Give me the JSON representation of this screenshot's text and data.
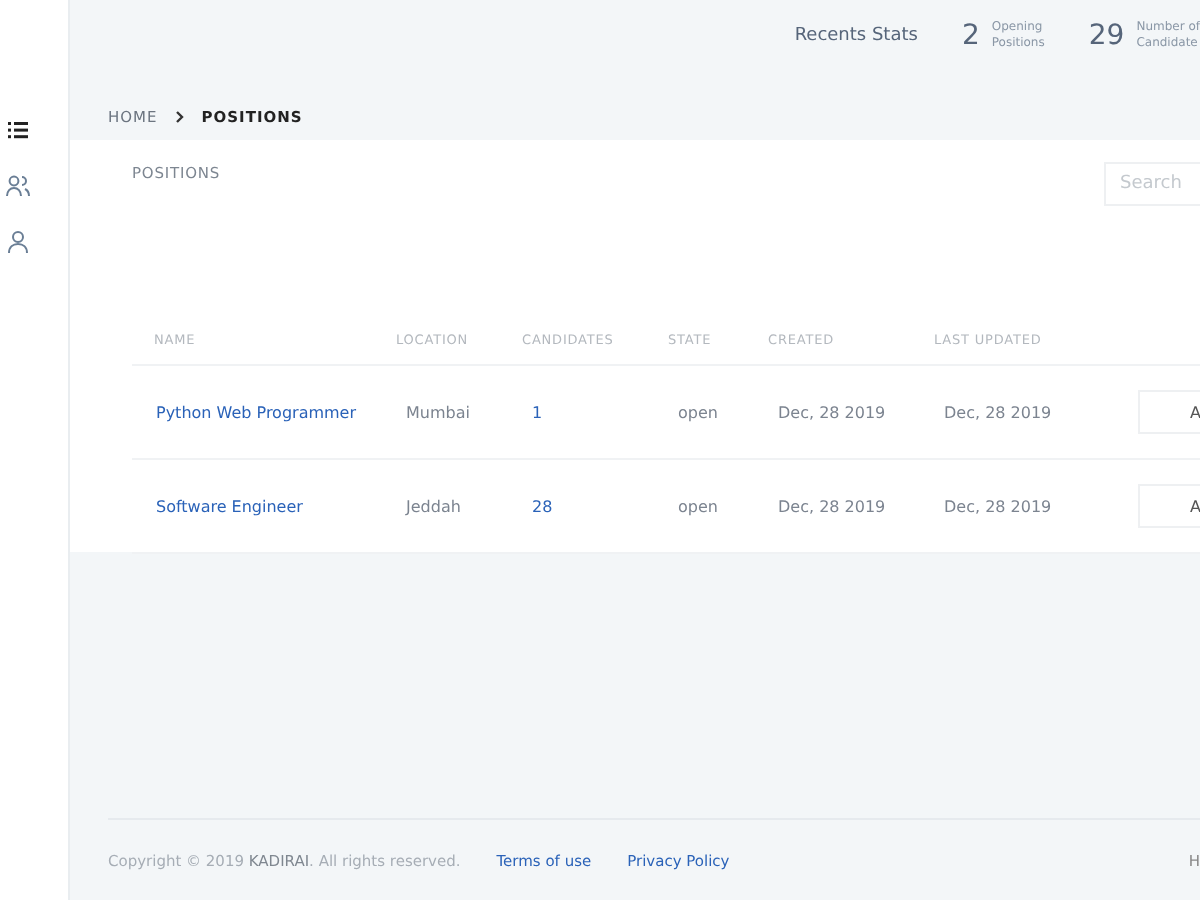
{
  "header": {
    "title": "Recents Stats",
    "stats": [
      {
        "value": "2",
        "label_lines": [
          "Opening",
          "Positions"
        ]
      },
      {
        "value": "29",
        "label_lines": [
          "Number of",
          "Candidate"
        ]
      }
    ]
  },
  "sidebar": {
    "items": [
      {
        "kind": "list",
        "selected": true
      },
      {
        "kind": "users",
        "selected": false
      },
      {
        "kind": "user",
        "selected": false
      }
    ]
  },
  "breadcrumb": {
    "items": [
      "HOME",
      "POSITIONS"
    ]
  },
  "card": {
    "title": "POSITIONS",
    "search": {
      "placeholder": "Search"
    }
  },
  "table": {
    "columns": [
      "NAME",
      "LOCATION",
      "CANDIDATES",
      "STATE",
      "CREATED",
      "LAST UPDATED"
    ],
    "rows": [
      {
        "name": "Python Web Programmer",
        "location": "Mumbai",
        "candidates": "1",
        "state": "open",
        "created": "Dec, 28 2019",
        "updated": "Dec, 28 2019",
        "action": "A"
      },
      {
        "name": "Software Engineer",
        "location": "Jeddah",
        "candidates": "28",
        "state": "open",
        "created": "Dec, 28 2019",
        "updated": "Dec, 28 2019",
        "action": "A"
      }
    ]
  },
  "footer": {
    "copyright": "Copyright © 2019 **KADIRAI**. All rights reserved.",
    "links": [
      "Terms of use",
      "Privacy Policy"
    ],
    "right": "H"
  }
}
